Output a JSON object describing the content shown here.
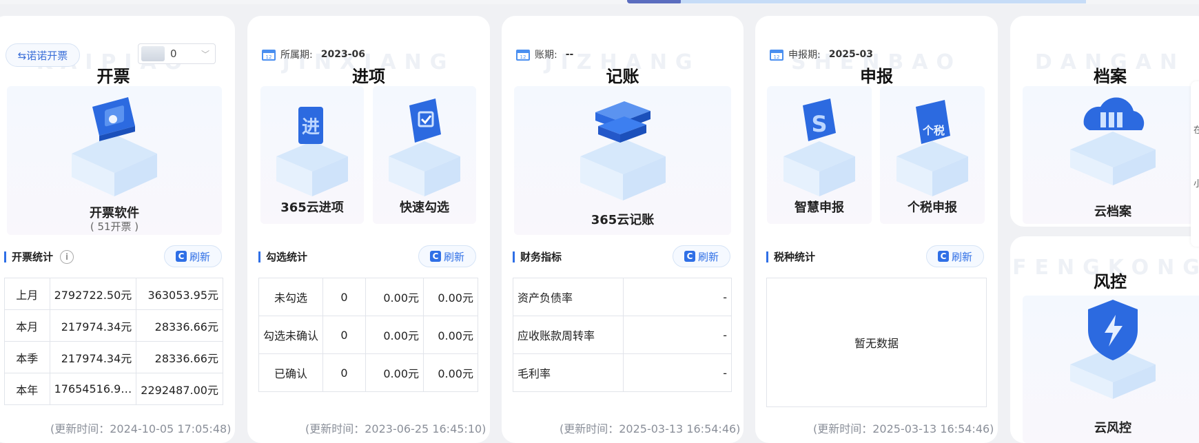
{
  "cards": {
    "kaipiao": {
      "watermark": "KAIPIAO",
      "title": "开票",
      "switch_label": "⇆诺诺开票",
      "device_value": "0",
      "feature_label": "开票软件",
      "feature_sub": "( 51开票 )",
      "section_title": "开票统计",
      "refresh": "刷新",
      "rows": [
        [
          "上月",
          "2792722.50元",
          "363053.95元"
        ],
        [
          "本月",
          "217974.34元",
          "28336.66元"
        ],
        [
          "本季",
          "217974.34元",
          "28336.66元"
        ],
        [
          "本年",
          "17654516.9…",
          "2292487.00元"
        ]
      ],
      "updated": "(更新时间：2024-10-05 17:05:48)"
    },
    "jinxiang": {
      "watermark": "JINXIANG",
      "title": "进项",
      "period_label": "所属期:",
      "period_value": "2023-06",
      "features": [
        "365云进项",
        "快速勾选"
      ],
      "section_title": "勾选统计",
      "refresh": "刷新",
      "rows": [
        [
          "未勾选",
          "0",
          "0.00元",
          "0.00元"
        ],
        [
          "勾选未确认",
          "0",
          "0.00元",
          "0.00元"
        ],
        [
          "已确认",
          "0",
          "0.00元",
          "0.00元"
        ]
      ],
      "updated": "(更新时间：2023-06-25 16:45:10)"
    },
    "jizhang": {
      "watermark": "JIZHANG",
      "title": "记账",
      "period_label": "账期:",
      "period_value": "--",
      "feature_label": "365云记账",
      "section_title": "财务指标",
      "refresh": "刷新",
      "rows": [
        [
          "资产负债率",
          "-"
        ],
        [
          "应收账款周转率",
          "-"
        ],
        [
          "毛利率",
          "-"
        ]
      ],
      "updated": "(更新时间：2025-03-13 16:54:46)"
    },
    "shenbao": {
      "watermark": "SHENBAO",
      "title": "申报",
      "period_label": "申报期:",
      "period_value": "2025-03",
      "features": [
        "智慧申报",
        "个税申报"
      ],
      "section_title": "税种统计",
      "refresh": "刷新",
      "empty": "暂无数据",
      "updated": "(更新时间：2025-03-13 16:54:46)"
    },
    "dangan": {
      "watermark": "DANGAN",
      "title": "档案",
      "feature_label": "云档案"
    },
    "fengkong": {
      "watermark": "FENGKONG",
      "title": "风控",
      "feature_label": "云风控"
    }
  },
  "side_panel": [
    "在",
    "小"
  ],
  "colors": {
    "accent": "#2f6fe6",
    "card_bg": "#ffffff",
    "page_bg": "#f0f1f4"
  }
}
